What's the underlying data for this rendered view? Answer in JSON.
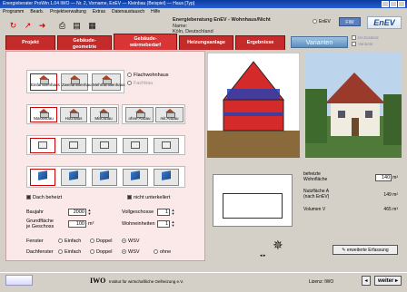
{
  "window": {
    "title": "Energieberater ProWin 1.04 IWO — Nr. 2, Vorname, EnEV — Kleinbau (Beispiel) — Haus [Typ]"
  },
  "menu": [
    "Programm",
    "Bearb.",
    "Projektverwaltung",
    "Extras",
    "Datenaustausch",
    "Hilfe"
  ],
  "toolbar": {
    "icons": [
      "new-icon",
      "open-icon",
      "save-icon",
      "print-icon",
      "print-preview-icon",
      "calculator-icon"
    ]
  },
  "project": {
    "title": "Energieberatung EnEV - Wohnhaus/Nicht",
    "line2": "Name:",
    "line3": "Köln, Deutschland"
  },
  "mode": {
    "enev": "EnEV",
    "fiw": "FIW"
  },
  "logo": "EnEV",
  "tabs": [
    {
      "label": "Projekt"
    },
    {
      "label": "Gebäude-\ngeometrie"
    },
    {
      "label": "Gebäude-\nwärmebedarf"
    },
    {
      "label": "Heizungsanlage"
    },
    {
      "label": "Ergebnisse"
    }
  ],
  "variant_button": "Varianten",
  "side_checks": [
    "Ist-Zustand",
    "Variante"
  ],
  "building_types": {
    "row1": [
      "Einfamilienhaus",
      "Zweifamilienhaus",
      "Mehrfamilienhaus"
    ],
    "options": [
      "Flachwohnhaus",
      "Fachbau"
    ],
    "row2": [
      "Massivbau",
      "Holzhaus",
      "Mischbau",
      "ohne Anbau",
      "mit Anbau"
    ]
  },
  "dach_beheizt": "Dach beheizt",
  "nicht_unterkellert": "nicht unterkellert",
  "baujahr": {
    "label": "Baujahr",
    "value": "2000"
  },
  "grundflaeche": {
    "label": "Grundfläche\nje Geschoss",
    "value": "100",
    "unit": "m²"
  },
  "vollgeschosse": {
    "label": "Vollgeschosse",
    "value": "1"
  },
  "wohneinheiten": {
    "label": "Wohneinheiten",
    "value": "1"
  },
  "fenster": {
    "label": "Fenster",
    "options": [
      "Einfach",
      "Doppel",
      "WSV"
    ],
    "selected": 2
  },
  "dachfenster": {
    "label": "Dachfenster",
    "options": [
      "Einfach",
      "Doppel",
      "WSV",
      "ohne"
    ],
    "selected": 2
  },
  "results": {
    "beheizte": {
      "label": "beheizte\nWohnfläche",
      "value": "140",
      "unit": "m²"
    },
    "nutzflaeche": {
      "label": "Nutzfläche A\n(nach EnEV)",
      "value": "149",
      "unit": "m²"
    },
    "volumen": {
      "label": "Volumen V",
      "value": "465",
      "unit": "m³"
    }
  },
  "erweiterte_button": "erweiterte Erfassung",
  "status": {
    "company": "IWO",
    "company_text": "Institut für wirtschaftliche Oelheizung e.V.",
    "location": "Lizenz: IWO",
    "weiter": "weiter"
  },
  "colors": {
    "accent": "#c42b2b",
    "panel": "#fbe9e9",
    "blue": "#1a4b8c"
  }
}
